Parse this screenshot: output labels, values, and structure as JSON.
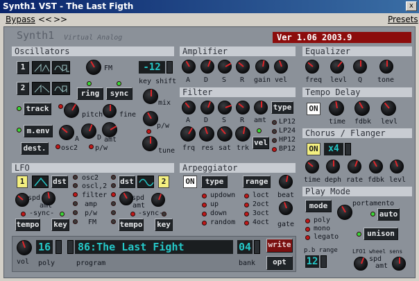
{
  "window": {
    "title": "Synth1 VST - The Last Figth",
    "close": "x"
  },
  "menu": {
    "bypass": "Bypass",
    "prev": "<<",
    "next": ">>",
    "presets": "Presets"
  },
  "brand": {
    "name": "Synth1",
    "sub": "Virtual Analog",
    "version": "Ver 1.06 2003.9"
  },
  "osc": {
    "title": "Oscillators",
    "osc1": "1",
    "osc2": "2",
    "fm": "FM",
    "ring": "ring",
    "sync": "sync",
    "track": "track",
    "pitch": "pitch",
    "fine": "fine",
    "menv": "m.env",
    "dest": "dest.",
    "osc2lbl": "osc2",
    "a": "A",
    "d": "D",
    "amt": "amt",
    "pw": "p/w",
    "keyshift": "key shift",
    "keyshift_val": "-12",
    "mix": "mix",
    "pw2": "p/w",
    "tune": "tune"
  },
  "amp": {
    "title": "Amplifier",
    "labels": [
      "A",
      "D",
      "S",
      "R",
      "gain",
      "vel"
    ]
  },
  "filter": {
    "title": "Filter",
    "labels": [
      "A",
      "D",
      "S",
      "R",
      "amt"
    ],
    "labels2": [
      "frq",
      "res",
      "sat",
      "trk"
    ],
    "type": "type",
    "vel": "vel",
    "types": [
      "LP12",
      "LP24",
      "HP12",
      "BP12"
    ]
  },
  "eq": {
    "title": "Equalizer",
    "labels": [
      "freq",
      "levl",
      "Q",
      "tone"
    ]
  },
  "delay": {
    "title": "Tempo Delay",
    "on": "ON",
    "labels": [
      "time",
      "fdbk",
      "levl"
    ]
  },
  "chorus": {
    "title": "Chorus / Flanger",
    "on": "ON",
    "mode": "x4",
    "labels": [
      "time",
      "deph",
      "rate",
      "fdbk",
      "levl"
    ]
  },
  "lfo": {
    "title": "LFO",
    "n1": "1",
    "n2": "2",
    "dst": "dst",
    "targets": [
      "osc2",
      "oscl,2",
      "filter",
      "amp",
      "p/w",
      "FM"
    ],
    "spd": "spd",
    "amt": "amt",
    "sync": "-sync-",
    "tempo": "tempo",
    "key": "key"
  },
  "arp": {
    "title": "Arpeggiator",
    "on": "ON",
    "type": "type",
    "range": "range",
    "types": [
      "updown",
      "up",
      "down",
      "random"
    ],
    "ranges": [
      "loct",
      "2oct",
      "3oct",
      "4oct"
    ],
    "beat": "beat",
    "gate": "gate"
  },
  "play": {
    "title": "Play Mode",
    "mode": "mode",
    "modes": [
      "poly",
      "mono",
      "legato"
    ],
    "portamento": "portamento",
    "auto": "auto",
    "unison": "unison",
    "pb_range": "p.b range",
    "pb_val": "12",
    "lfo1": "LFO1 wheel sens",
    "spd": "spd",
    "amt": "amt"
  },
  "bottom": {
    "vol": "vol",
    "poly": "poly",
    "poly_val": "16",
    "program": "program",
    "program_val": "86:The Last Fight",
    "bank": "bank",
    "bank_val": "04",
    "write": "write",
    "opt": "opt"
  }
}
